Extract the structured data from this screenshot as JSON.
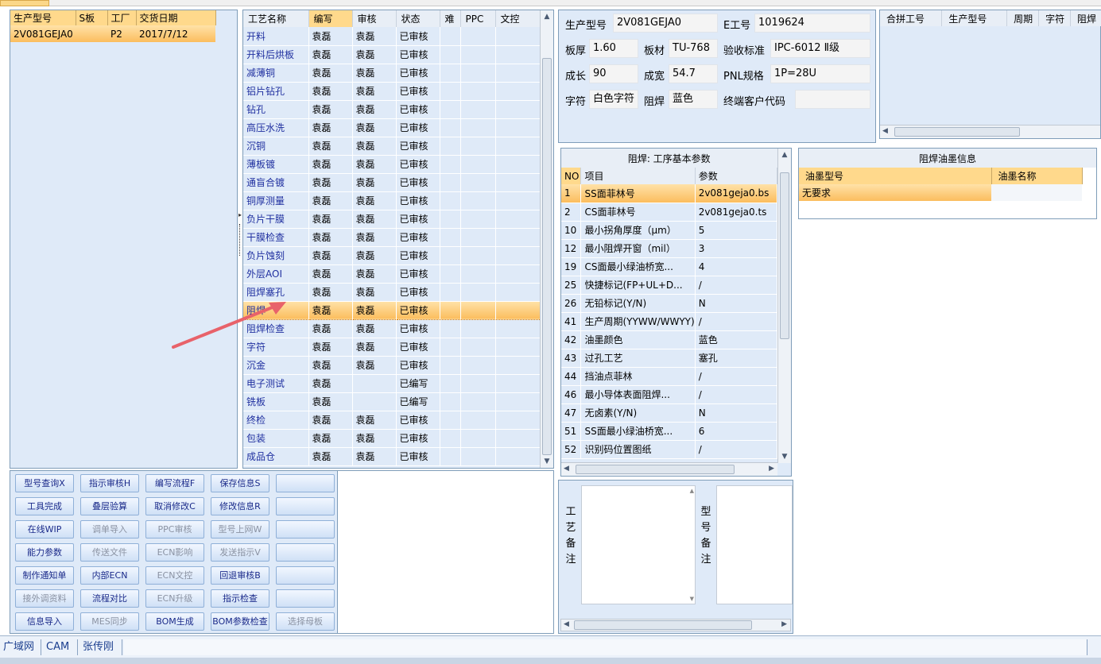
{
  "model_grid": {
    "headers": [
      "生产型号",
      "S板",
      "工厂",
      "交货日期"
    ],
    "rows": [
      {
        "model": "2V081GEJA0",
        "s": "",
        "factory": "P2",
        "date": "2017/7/12"
      }
    ]
  },
  "process_grid": {
    "headers": [
      "工艺名称",
      "编写",
      "审核",
      "状态",
      "难",
      "PPC",
      "文控"
    ],
    "rows": [
      {
        "name": "开料",
        "writer": "袁磊",
        "reviewer": "袁磊",
        "status": "已审核"
      },
      {
        "name": "开料后烘板",
        "writer": "袁磊",
        "reviewer": "袁磊",
        "status": "已审核"
      },
      {
        "name": "减薄铜",
        "writer": "袁磊",
        "reviewer": "袁磊",
        "status": "已审核"
      },
      {
        "name": "铝片钻孔",
        "writer": "袁磊",
        "reviewer": "袁磊",
        "status": "已审核"
      },
      {
        "name": "钻孔",
        "writer": "袁磊",
        "reviewer": "袁磊",
        "status": "已审核"
      },
      {
        "name": "高压水洗",
        "writer": "袁磊",
        "reviewer": "袁磊",
        "status": "已审核"
      },
      {
        "name": "沉铜",
        "writer": "袁磊",
        "reviewer": "袁磊",
        "status": "已审核"
      },
      {
        "name": "薄板镀",
        "writer": "袁磊",
        "reviewer": "袁磊",
        "status": "已审核"
      },
      {
        "name": "通盲合镀",
        "writer": "袁磊",
        "reviewer": "袁磊",
        "status": "已审核"
      },
      {
        "name": "铜厚测量",
        "writer": "袁磊",
        "reviewer": "袁磊",
        "status": "已审核"
      },
      {
        "name": "负片干膜",
        "writer": "袁磊",
        "reviewer": "袁磊",
        "status": "已审核"
      },
      {
        "name": "干膜检查",
        "writer": "袁磊",
        "reviewer": "袁磊",
        "status": "已审核"
      },
      {
        "name": "负片蚀刻",
        "writer": "袁磊",
        "reviewer": "袁磊",
        "status": "已审核"
      },
      {
        "name": "外层AOI",
        "writer": "袁磊",
        "reviewer": "袁磊",
        "status": "已审核"
      },
      {
        "name": "阻焊塞孔",
        "writer": "袁磊",
        "reviewer": "袁磊",
        "status": "已审核"
      },
      {
        "name": "阻焊",
        "writer": "袁磊",
        "reviewer": "袁磊",
        "status": "已审核"
      },
      {
        "name": "阻焊检查",
        "writer": "袁磊",
        "reviewer": "袁磊",
        "status": "已审核"
      },
      {
        "name": "字符",
        "writer": "袁磊",
        "reviewer": "袁磊",
        "status": "已审核"
      },
      {
        "name": "沉金",
        "writer": "袁磊",
        "reviewer": "袁磊",
        "status": "已审核"
      },
      {
        "name": "电子测试",
        "writer": "袁磊",
        "reviewer": "",
        "status": "已编写"
      },
      {
        "name": "铣板",
        "writer": "袁磊",
        "reviewer": "",
        "status": "已编写"
      },
      {
        "name": "终检",
        "writer": "袁磊",
        "reviewer": "袁磊",
        "status": "已审核"
      },
      {
        "name": "包装",
        "writer": "袁磊",
        "reviewer": "袁磊",
        "status": "已审核"
      },
      {
        "name": "成品仓",
        "writer": "袁磊",
        "reviewer": "袁磊",
        "status": "已审核"
      }
    ],
    "selected_index": 15
  },
  "buttons": [
    [
      "型号查询X",
      "指示审核H",
      "编写流程F",
      "保存信息S",
      ""
    ],
    [
      "工具完成",
      "叠层验算",
      "取消修改C",
      "修改信息R",
      ""
    ],
    [
      "在线WIP",
      "调单导入",
      "PPC审核",
      "型号上网W",
      ""
    ],
    [
      "能力参数",
      "传送文件",
      "ECN影响",
      "发送指示V",
      ""
    ],
    [
      "制作通知单",
      "内部ECN",
      "ECN文控",
      "回退审核B",
      ""
    ],
    [
      "接外调资料",
      "流程对比",
      "ECN升级",
      "指示检查",
      ""
    ],
    [
      "信息导入",
      "MES同步",
      "BOM生成",
      "BOM参数检查",
      "选择母板"
    ]
  ],
  "disabled_buttons": [
    "调单导入",
    "PPC审核",
    "型号上网W",
    "传送文件",
    "ECN影响",
    "发送指示V",
    "ECN文控",
    "接外调资料",
    "ECN升级",
    "MES同步",
    "选择母板"
  ],
  "info": {
    "model_label": "生产型号",
    "model_value": "2V081GEJA0",
    "e_label": "E工号",
    "e_value": "1019624",
    "thick_label": "板厚",
    "thick_value": "1.60",
    "material_label": "板材",
    "material_value": "TU-768",
    "std_label": "验收标准",
    "std_value": "IPC-6012 Ⅱ级",
    "len_label": "成长",
    "len_value": "90",
    "width_label": "成宽",
    "width_value": "54.7",
    "pnl_label": "PNL规格",
    "pnl_value": "1P=28U",
    "char_label": "字符",
    "char_value": "白色字符",
    "solder_label": "阻焊",
    "solder_value": "蓝色",
    "cust_label": "终端客户代码",
    "cust_value": ""
  },
  "comb_grid": {
    "headers": [
      "合拼工号",
      "生产型号",
      "周期",
      "字符",
      "阻焊"
    ]
  },
  "param_grid": {
    "caption": "阻焊: 工序基本参数",
    "headers": [
      "NO",
      "项目",
      "参数"
    ],
    "rows": [
      {
        "no": "1",
        "item": "SS面菲林号",
        "value": "2v081geja0.bs"
      },
      {
        "no": "2",
        "item": "CS面菲林号",
        "value": "2v081geja0.ts"
      },
      {
        "no": "10",
        "item": "最小拐角厚度（μm）",
        "value": "5"
      },
      {
        "no": "12",
        "item": "最小阻焊开窗（mil）",
        "value": "3"
      },
      {
        "no": "19",
        "item": "CS面最小绿油桥宽...",
        "value": "4"
      },
      {
        "no": "25",
        "item": "快捷标记(FP+UL+D...",
        "value": "/"
      },
      {
        "no": "26",
        "item": "无铅标记(Y/N)",
        "value": "N"
      },
      {
        "no": "41",
        "item": "生产周期(YYWW/WWYY)",
        "value": "/"
      },
      {
        "no": "42",
        "item": "油墨颜色",
        "value": "蓝色"
      },
      {
        "no": "43",
        "item": "过孔工艺",
        "value": "塞孔"
      },
      {
        "no": "44",
        "item": "挡油点菲林",
        "value": "/"
      },
      {
        "no": "46",
        "item": "最小导体表面阻焊...",
        "value": "/"
      },
      {
        "no": "47",
        "item": "无卤素(Y/N)",
        "value": "N"
      },
      {
        "no": "51",
        "item": "SS面最小绿油桥宽...",
        "value": "6"
      },
      {
        "no": "52",
        "item": "识别码位置图纸",
        "value": "/"
      }
    ]
  },
  "ink_grid": {
    "caption": "阻焊油墨信息",
    "headers": [
      "油墨型号",
      "油墨名称"
    ],
    "rows": [
      {
        "type": "无要求",
        "name": ""
      }
    ]
  },
  "notes": {
    "process_note_label": [
      "工",
      "艺",
      "备",
      "注"
    ],
    "model_note_label": [
      "型",
      "号",
      "备",
      "注"
    ]
  },
  "status_bar": {
    "network": "广域网",
    "dept": "CAM",
    "user": "张传刚"
  },
  "colors": {
    "selection": "#fbbd5e",
    "header_active": "#ffd98c",
    "panel_bg": "#dfeaf8",
    "annotation_arrow": "#e8626a"
  }
}
